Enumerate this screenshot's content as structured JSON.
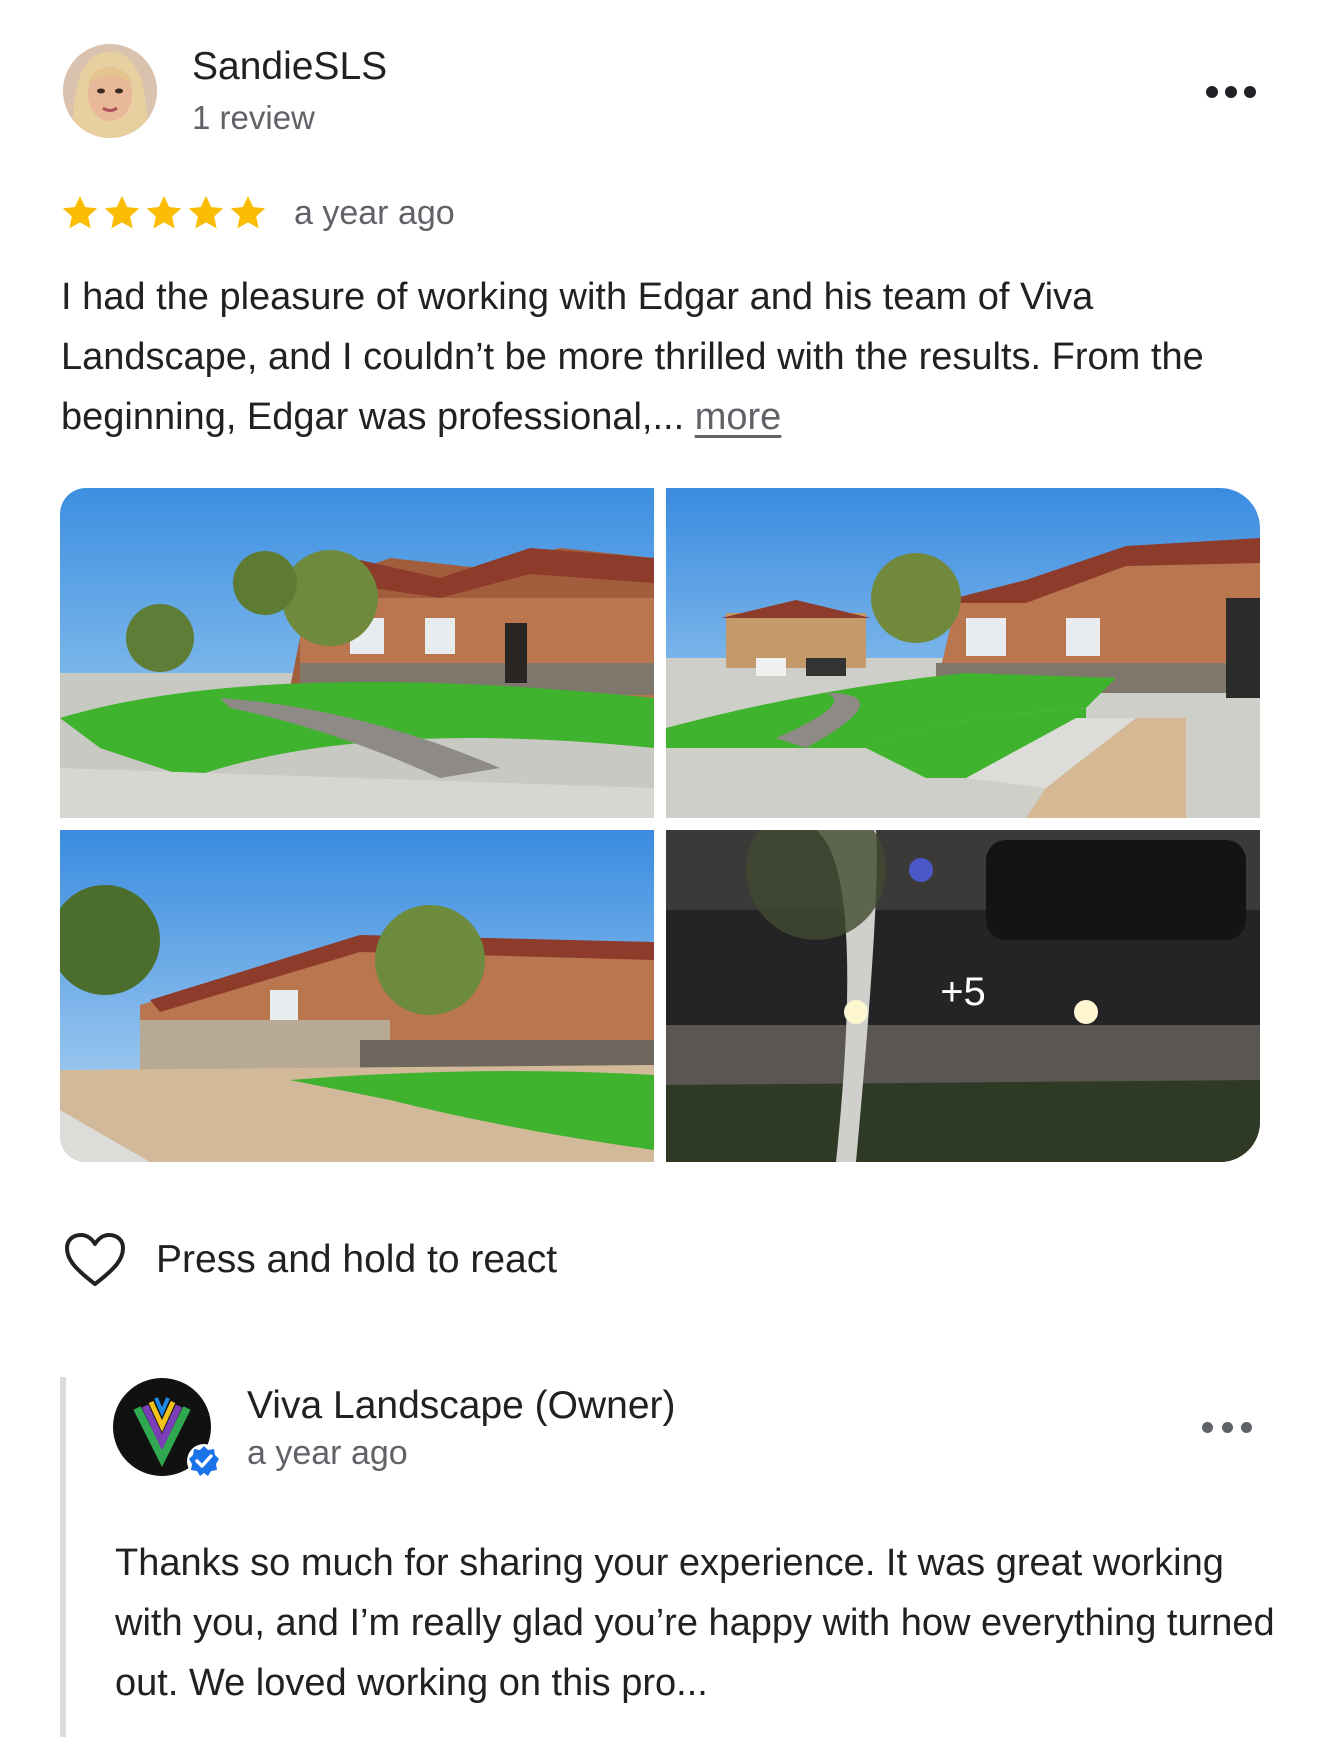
{
  "review": {
    "reviewer_name": "SandieSLS",
    "review_count": "1 review",
    "rating": 5,
    "rating_max": 5,
    "time": "a year ago",
    "text": "I had the pleasure of working with Edgar and his team of Viva Landscape, and I couldn’t be more thrilled with the results. From the beginning, Edgar was professional,... ",
    "more_label": "more",
    "photos_more_label": "+5",
    "react_label": "Press and hold to react"
  },
  "owner_reply": {
    "name": "Viva Landscape (Owner)",
    "time": "a year ago",
    "text": "Thanks so much for sharing your experience. It was great working with you, and I’m really glad you’re happy with how everything turned out. We loved working on this pro..."
  },
  "colors": {
    "star": "#fbbc04",
    "text_primary": "#202124",
    "text_secondary": "#5f6368",
    "verified": "#1a73e8"
  },
  "icons": [
    "reviewer-avatar",
    "more-options-icon",
    "star-icon",
    "heart-icon",
    "viva-landscape-logo",
    "verified-badge-icon"
  ]
}
